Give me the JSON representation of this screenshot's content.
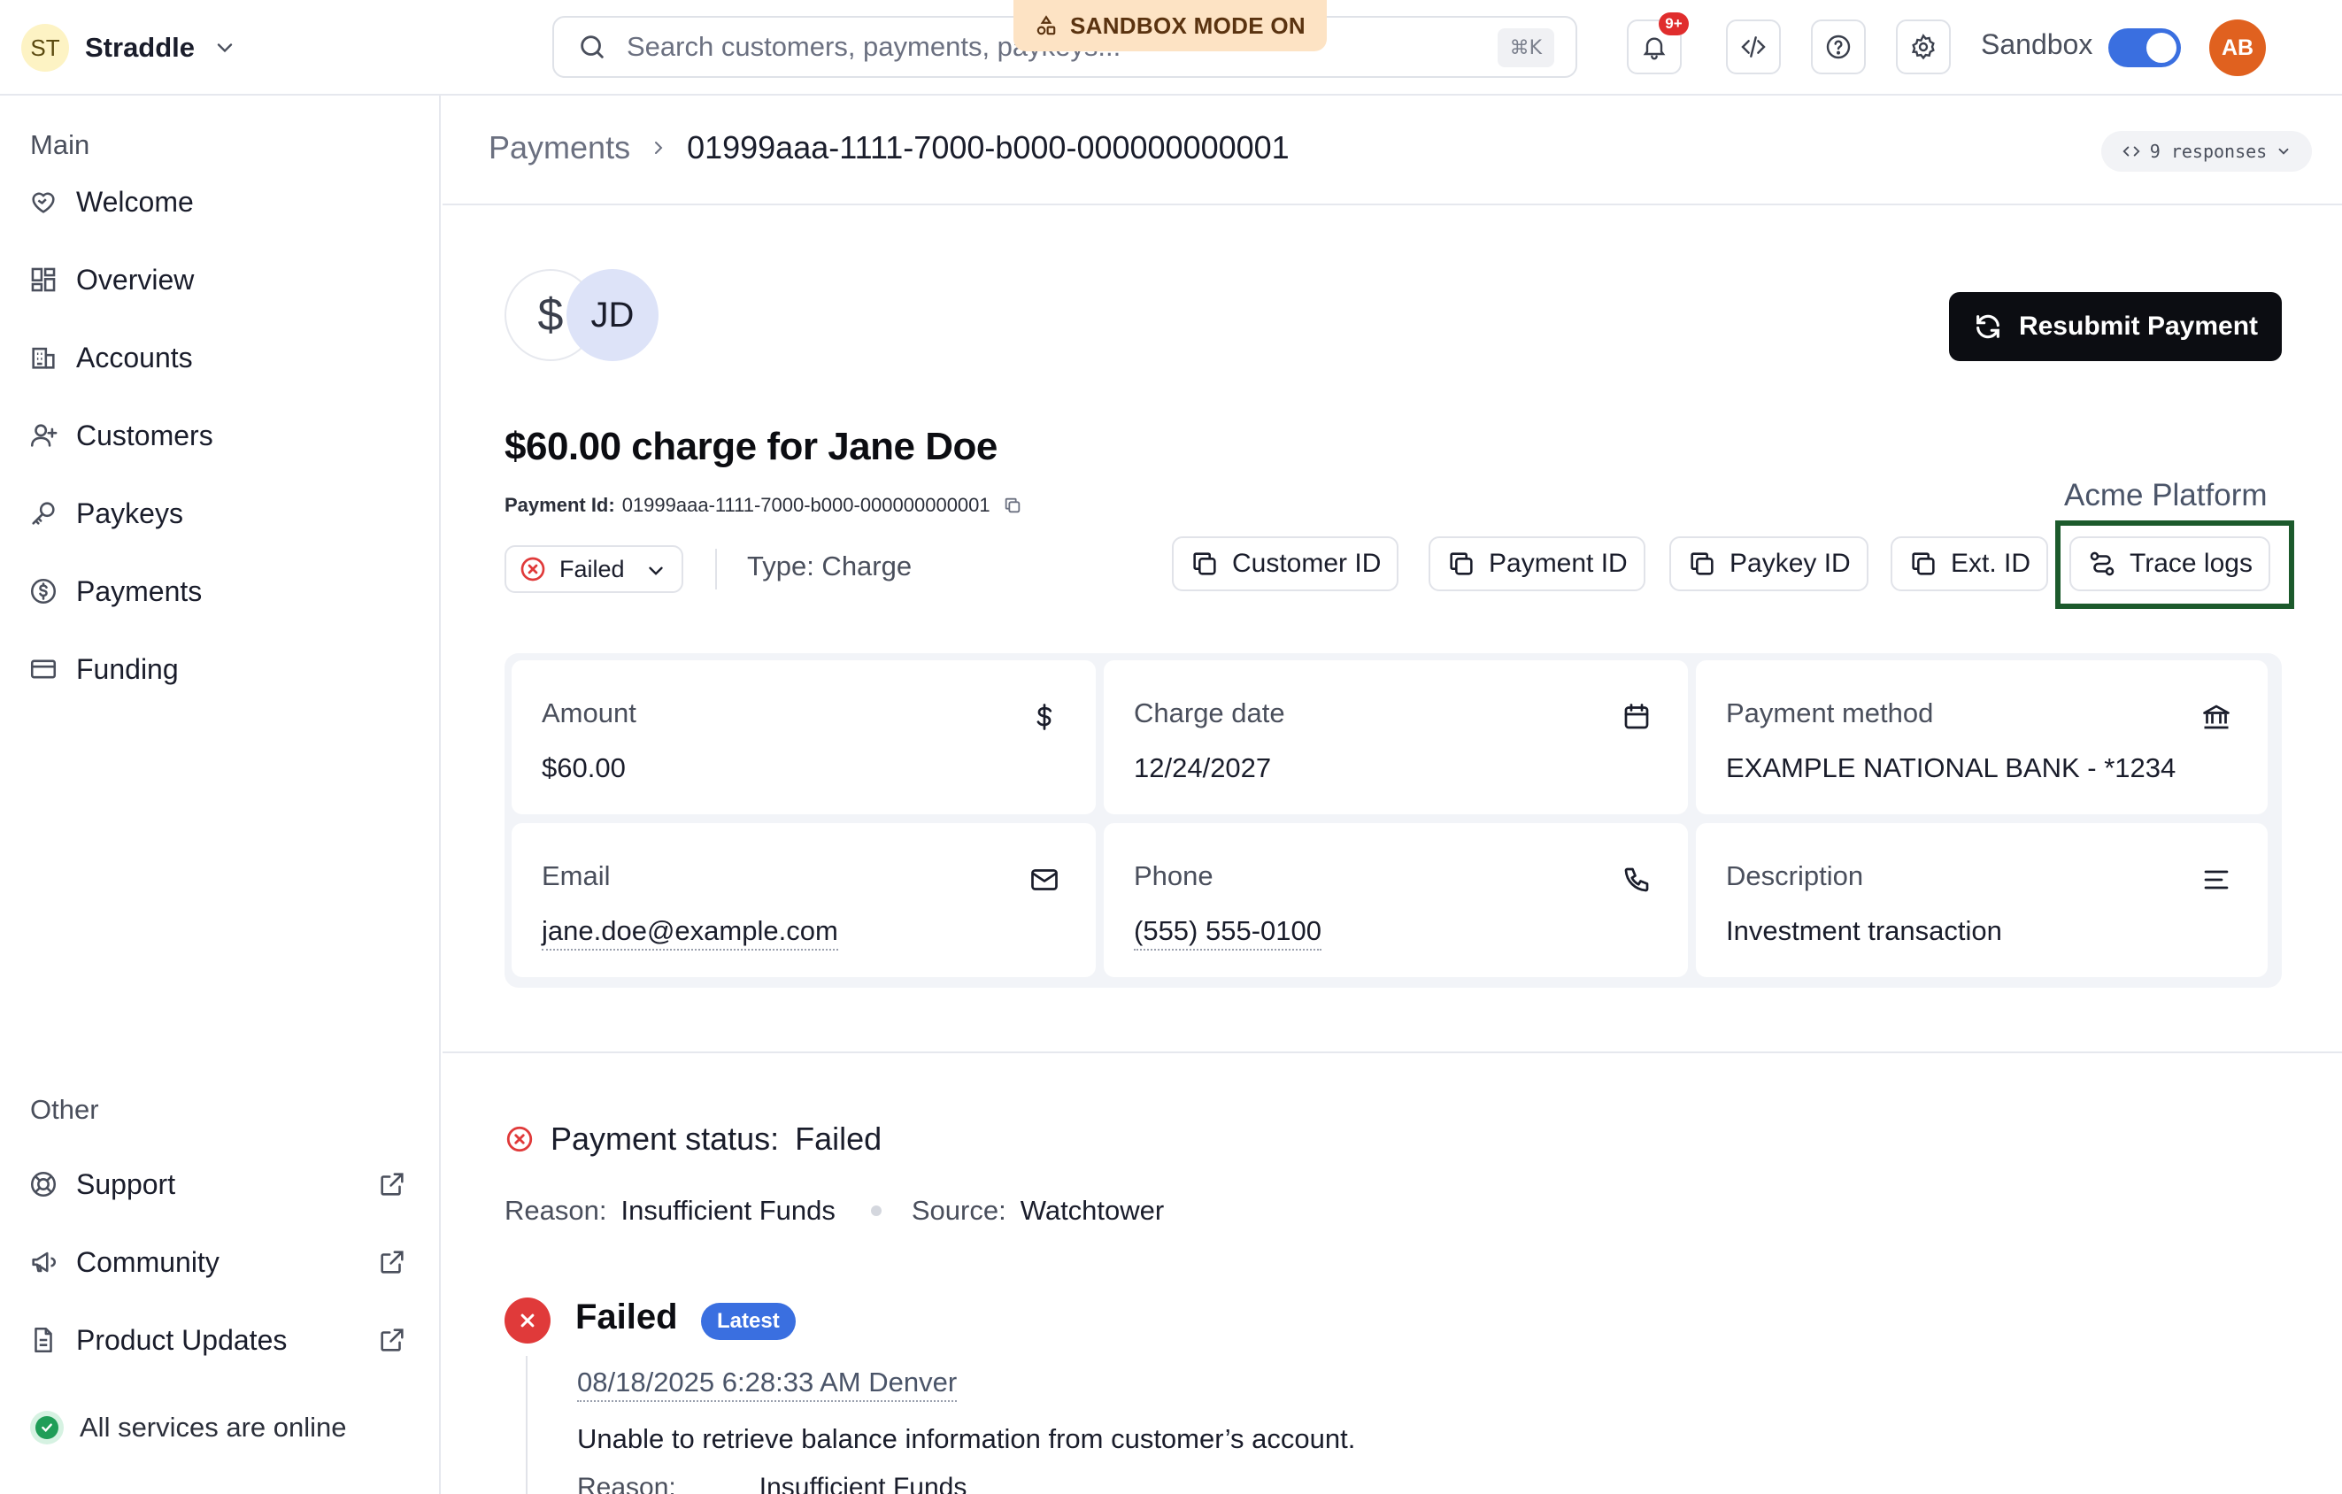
{
  "topbar": {
    "org_initials": "ST",
    "org_name": "Straddle",
    "search_placeholder": "Search customers, payments, paykeys...",
    "search_shortcut": "⌘K",
    "sandbox_banner": "SANDBOX MODE ON",
    "notifications_badge": "9+",
    "environment_label": "Sandbox",
    "environment_toggle_on": true,
    "user_initials": "AB"
  },
  "sidebar": {
    "main_label": "Main",
    "main_items": [
      {
        "label": "Welcome",
        "icon": "heart-handshake-icon"
      },
      {
        "label": "Overview",
        "icon": "dashboard-icon"
      },
      {
        "label": "Accounts",
        "icon": "building-icon"
      },
      {
        "label": "Customers",
        "icon": "user-plus-icon"
      },
      {
        "label": "Paykeys",
        "icon": "key-icon"
      },
      {
        "label": "Payments",
        "icon": "dollar-circle-icon"
      },
      {
        "label": "Funding",
        "icon": "credit-card-icon"
      }
    ],
    "other_label": "Other",
    "other_items": [
      {
        "label": "Support",
        "icon": "lifebuoy-icon"
      },
      {
        "label": "Community",
        "icon": "megaphone-icon"
      },
      {
        "label": "Product Updates",
        "icon": "document-icon"
      }
    ],
    "status_text": "All services are online"
  },
  "breadcrumb": {
    "parent": "Payments",
    "current": "01999aaa-1111-7000-b000-000000000001"
  },
  "responses_pill": "9 responses",
  "payment": {
    "avatar_symbol": "$",
    "customer_initials": "JD",
    "resubmit_label": "Resubmit Payment",
    "title": "$60.00 charge for Jane Doe",
    "id_label": "Payment Id:",
    "id_value": "01999aaa-1111-7000-b000-000000000001",
    "platform": "Acme Platform",
    "status": "Failed",
    "type": "Type: Charge",
    "id_buttons": [
      "Customer ID",
      "Payment ID",
      "Paykey ID",
      "Ext. ID"
    ],
    "trace_logs_label": "Trace logs"
  },
  "details": {
    "amount_label": "Amount",
    "amount_value": "$60.00",
    "charge_date_label": "Charge date",
    "charge_date_value": "12/24/2027",
    "payment_method_label": "Payment method",
    "payment_method_value": "EXAMPLE NATIONAL BANK - *1234",
    "email_label": "Email",
    "email_value": "jane.doe@example.com",
    "phone_label": "Phone",
    "phone_value": "(555) 555-0100",
    "description_label": "Description",
    "description_value": "Investment transaction"
  },
  "status_section": {
    "heading_label": "Payment status:",
    "heading_value": "Failed",
    "reason_label": "Reason:",
    "reason_value": "Insufficient Funds",
    "source_label": "Source:",
    "source_value": "Watchtower"
  },
  "timeline": {
    "event_title": "Failed",
    "event_badge": "Latest",
    "event_datetime": "08/18/2025 6:28:33 AM Denver",
    "event_message": "Unable to retrieve balance information from customer’s account.",
    "event_reason_label": "Reason:",
    "event_reason_value": "Insufficient Funds"
  },
  "colors": {
    "accent": "#3a6fe0",
    "danger": "#e03a3a",
    "sandbox_banner_bg": "#fde3c4",
    "highlight_border": "#1c5a2c",
    "success": "#1f9d57"
  }
}
